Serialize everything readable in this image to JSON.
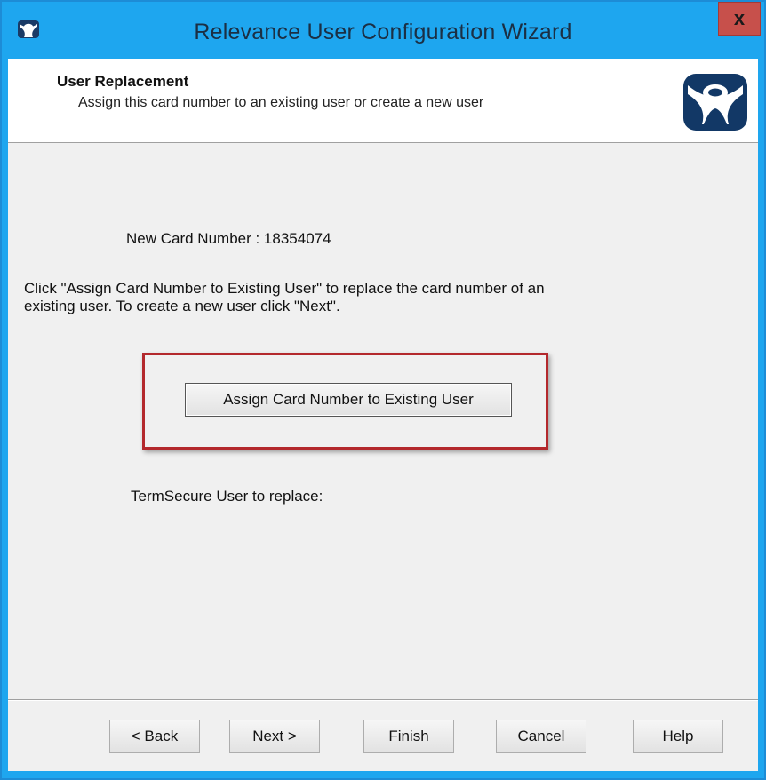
{
  "window": {
    "title": "Relevance User Configuration Wizard",
    "close_label": "x",
    "title_icon": "app-icon",
    "accent_color": "#1ea6ef"
  },
  "header": {
    "title": "User Replacement",
    "subtitle": "Assign this card number to an existing user or create a new user",
    "logo_icon": "relevance-logo"
  },
  "body": {
    "card_number_text": "New Card Number : 18354074",
    "instructions_line1": "Click \"Assign Card Number to Existing User\" to replace the card number  of an",
    "instructions_line2": "existing user. To create a new user click \"Next\".",
    "assign_button_label": "Assign Card Number to Existing User",
    "replace_label": "TermSecure User to replace:",
    "highlight_color": "#b3282c"
  },
  "footer": {
    "back_label": "< Back",
    "next_label": "Next >",
    "finish_label": "Finish",
    "cancel_label": "Cancel",
    "help_label": "Help"
  }
}
